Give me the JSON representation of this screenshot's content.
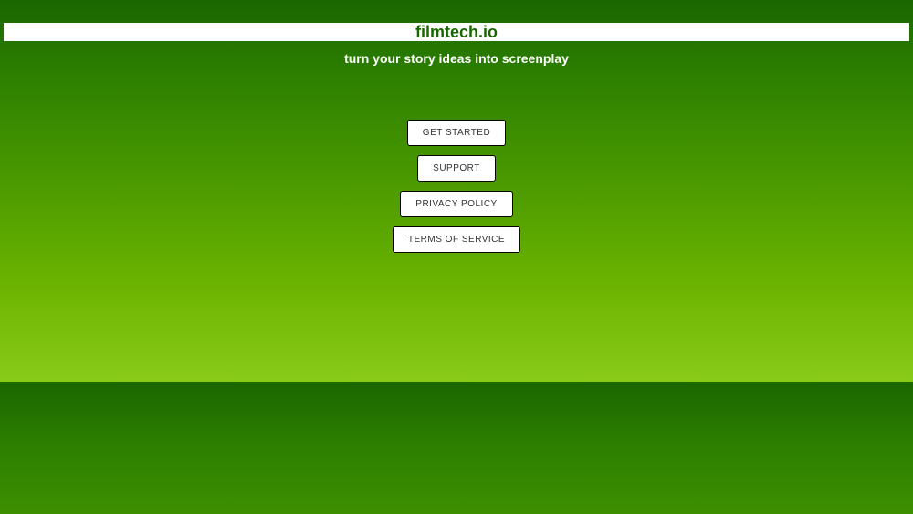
{
  "header": {
    "title": "filmtech.io"
  },
  "tagline": "turn your story ideas into screenplay",
  "buttons": {
    "get_started": "GET STARTED",
    "support": "SUPPORT",
    "privacy": "PRIVACY POLICY",
    "terms": "TERMS OF SERVICE"
  }
}
